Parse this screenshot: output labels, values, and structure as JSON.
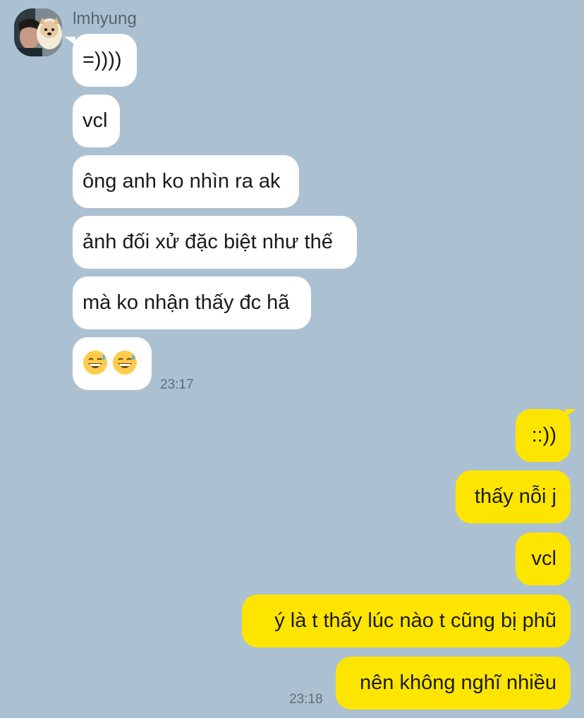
{
  "chat": {
    "sender": {
      "name": "lmhyung",
      "avatar_icon": "profile-photo-with-dog"
    },
    "incoming": [
      {
        "text": "=))))"
      },
      {
        "text": "vcl"
      },
      {
        "text": "ông anh ko nhìn ra ak"
      },
      {
        "text": "ảnh đối xử đặc biệt như thế"
      },
      {
        "text": "mà ko nhận thấy đc hã"
      },
      {
        "text": "",
        "emoji": [
          "grinning-face-with-sweat-icon",
          "grinning-face-with-sweat-icon"
        ]
      }
    ],
    "incoming_time": "23:17",
    "outgoing": [
      {
        "text": "::))"
      },
      {
        "text": "thấy nỗi j"
      },
      {
        "text": "vcl"
      },
      {
        "text": "ý là t thấy lúc nào t cũng bị phũ"
      },
      {
        "text": "nên không nghĩ nhiều"
      }
    ],
    "outgoing_time": "23:18",
    "colors": {
      "background": "#abc1d1",
      "incoming_bubble": "#ffffff",
      "outgoing_bubble": "#fee500"
    }
  }
}
